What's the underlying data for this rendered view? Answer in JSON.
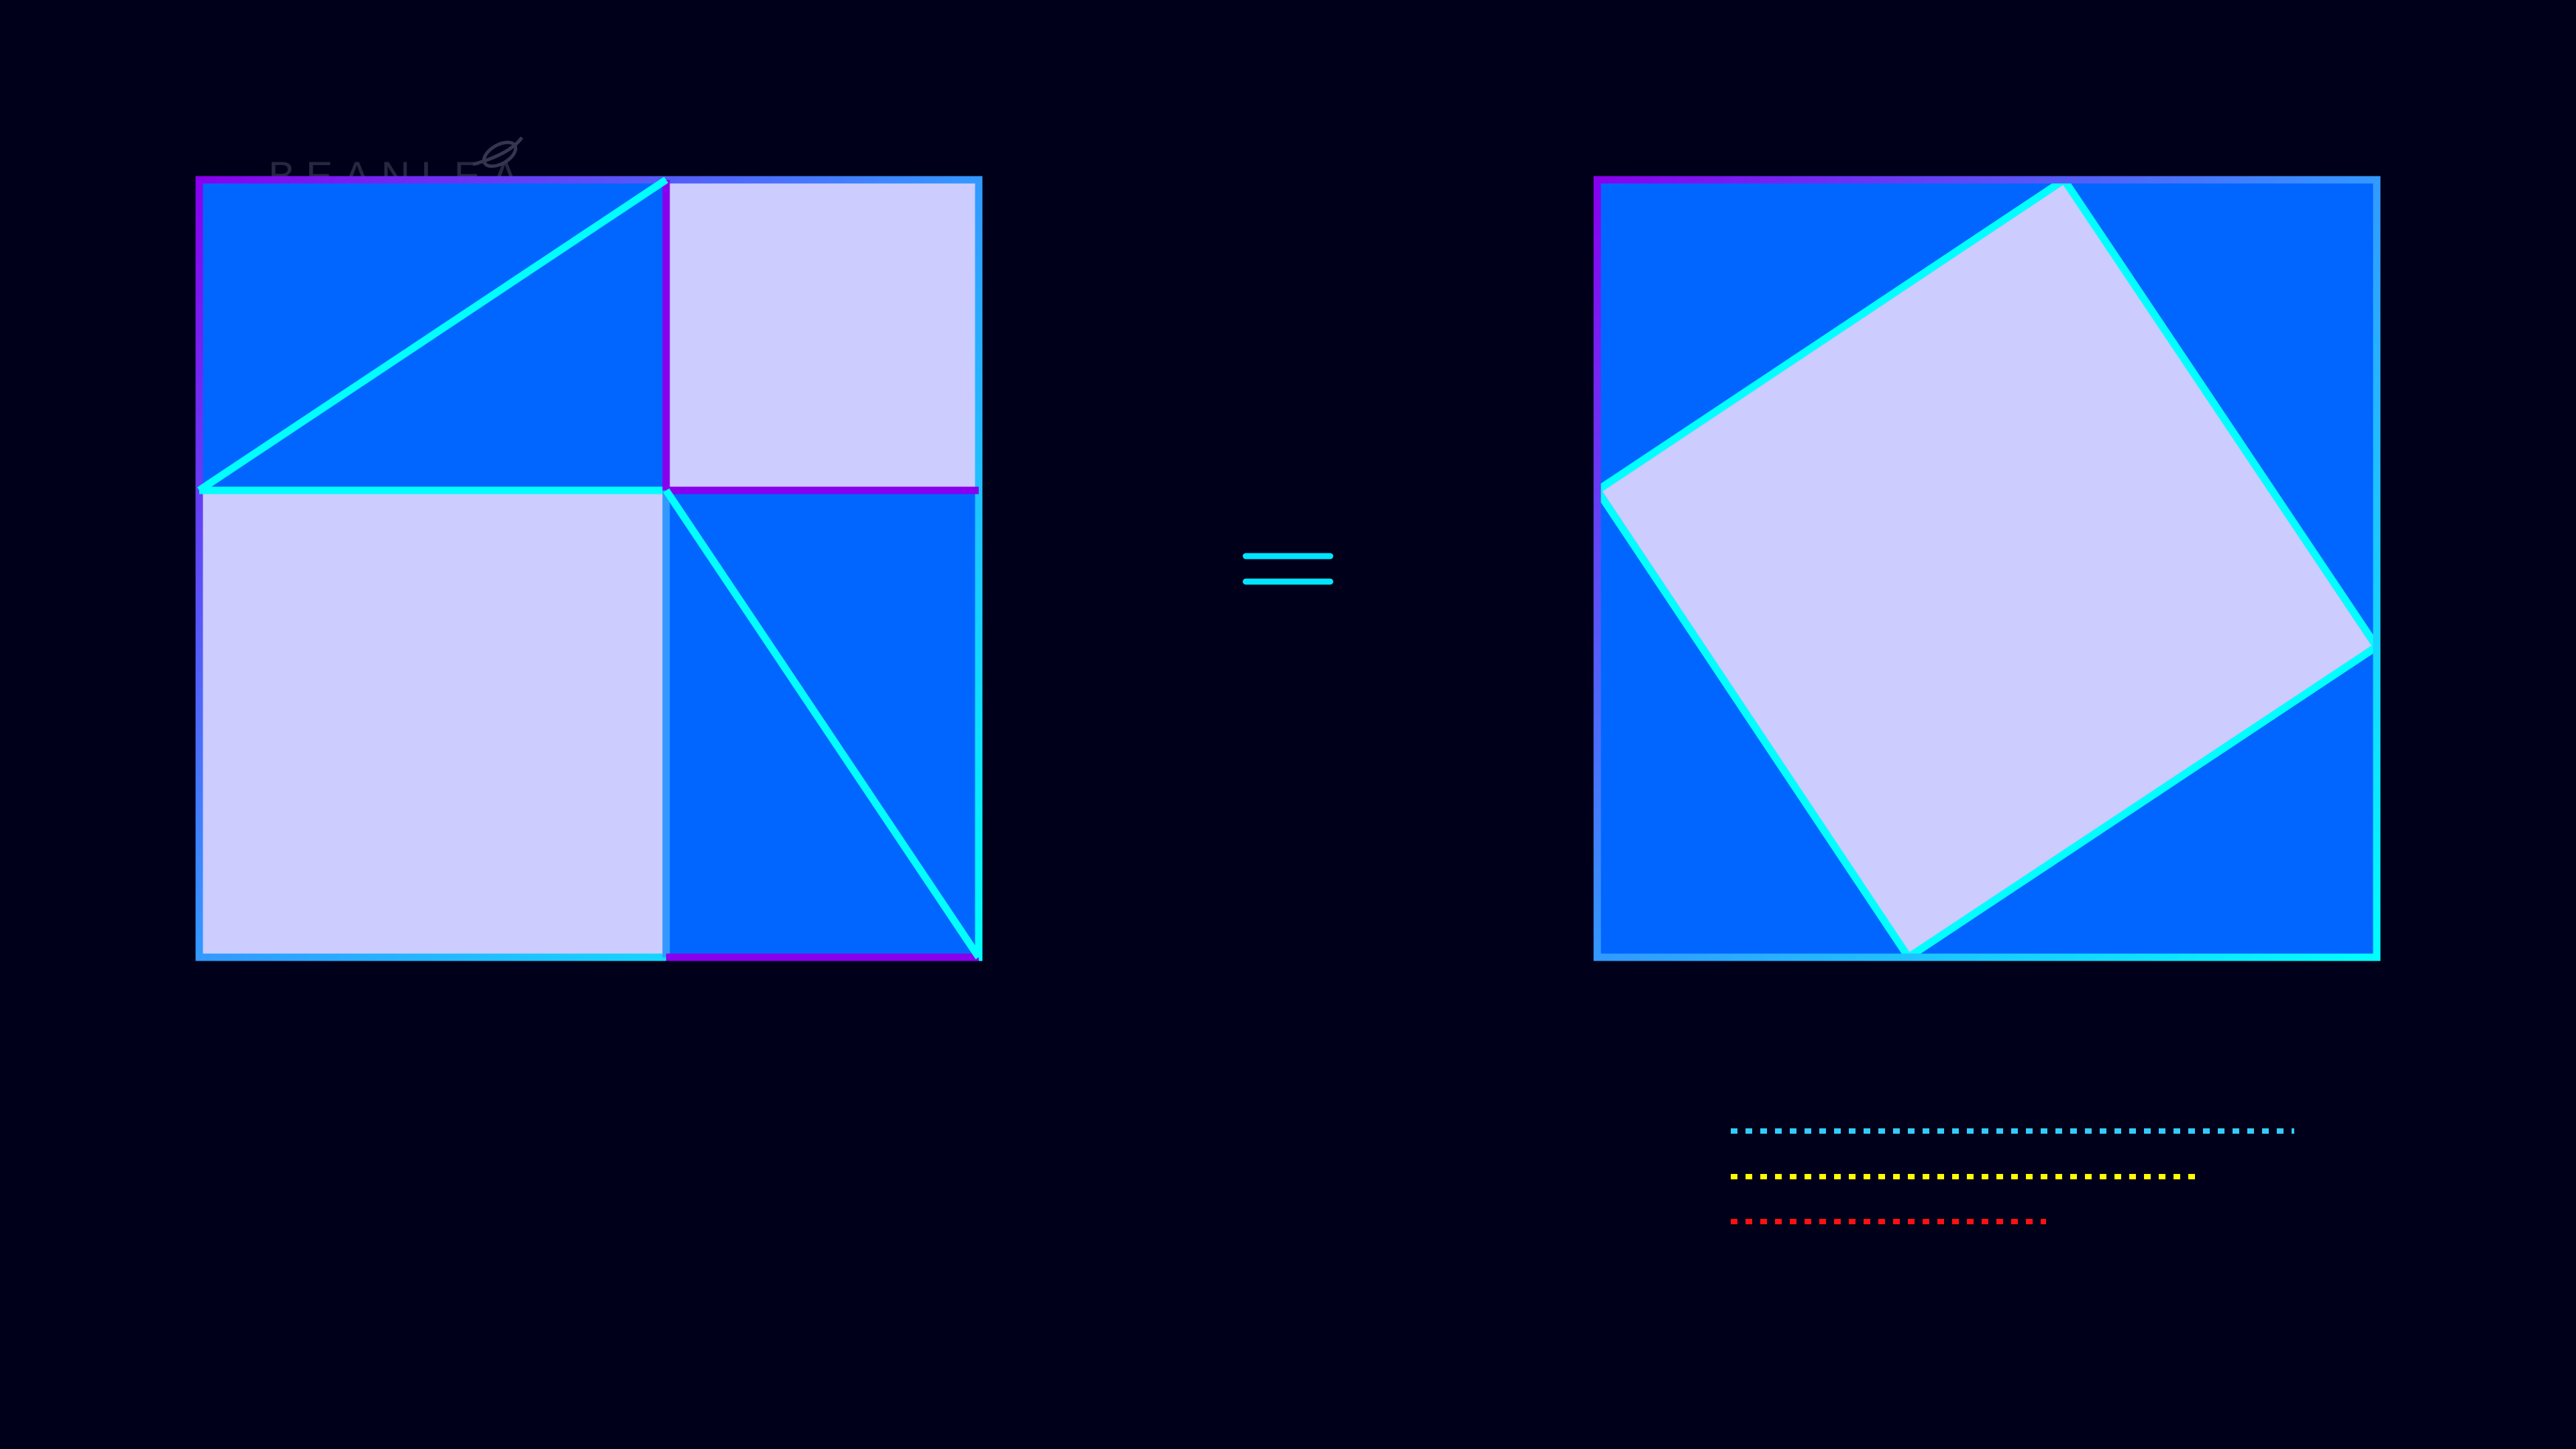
{
  "colors": {
    "background": "#00001a",
    "triangle_fill": "#0066ff",
    "square_fill": "#ccccff",
    "edge_cyan": "#00ffff",
    "edge_blue": "#3399ff",
    "edge_violet": "#8800ee",
    "equals": "#00e5ff",
    "legend_cyan": "#33ccff",
    "legend_yellow": "#ffff00",
    "legend_red": "#ff1111"
  },
  "watermark": {
    "text": "BEANLEA",
    "color": "#262840"
  },
  "icons": {
    "equals_sign": "equals-sign-icon",
    "watermark_leaf": "leaf-logo-icon"
  },
  "legend": [
    {
      "name": "cyan",
      "color": "#33ccff"
    },
    {
      "name": "yellow",
      "color": "#ffff00"
    },
    {
      "name": "red",
      "color": "#ff1111"
    }
  ]
}
